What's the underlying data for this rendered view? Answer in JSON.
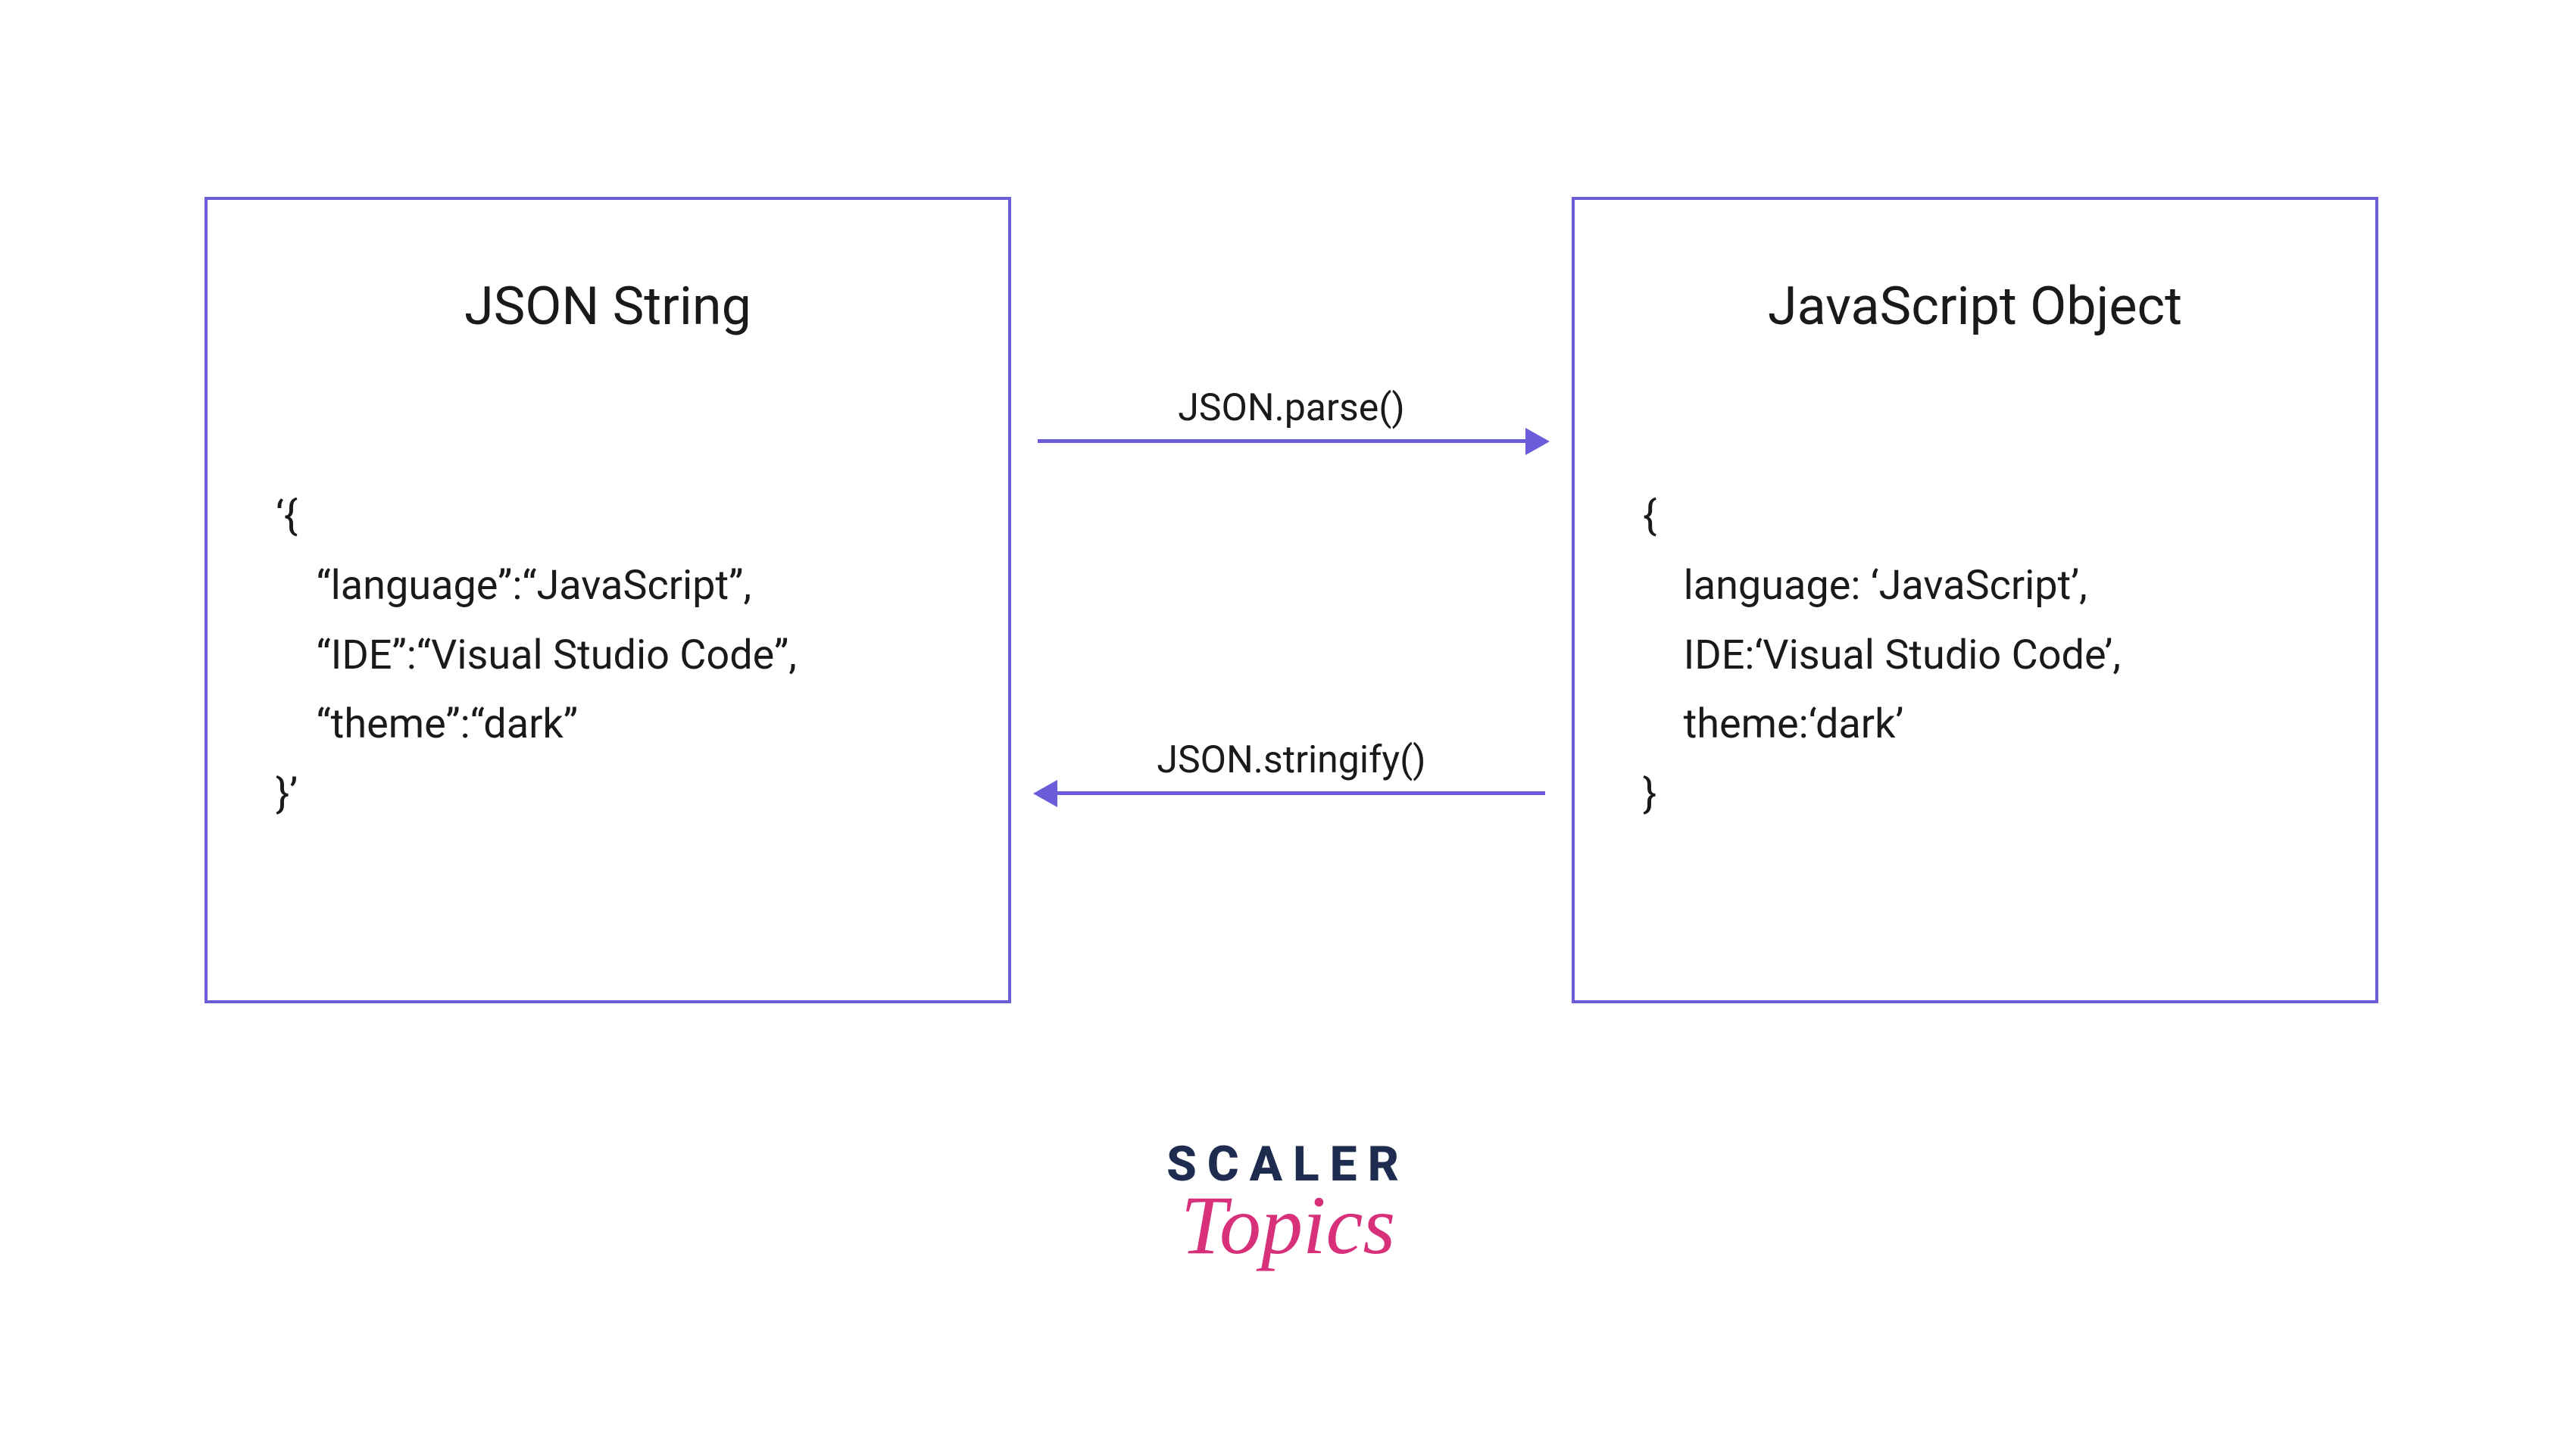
{
  "leftBox": {
    "title": "JSON String",
    "code": "‘{\n    “language”:“JavaScript”,\n    “IDE”:“Visual Studio Code”,\n    “theme”:“dark”\n}’"
  },
  "rightBox": {
    "title": "JavaScript Object",
    "code": "{\n    language: ‘JavaScript’,\n    IDE:‘Visual Studio Code’,\n    theme:‘dark’\n}"
  },
  "arrows": {
    "top": "JSON.parse()",
    "bottom": "JSON.stringify()"
  },
  "logo": {
    "line1": "SCALER",
    "line2": "Topics"
  }
}
